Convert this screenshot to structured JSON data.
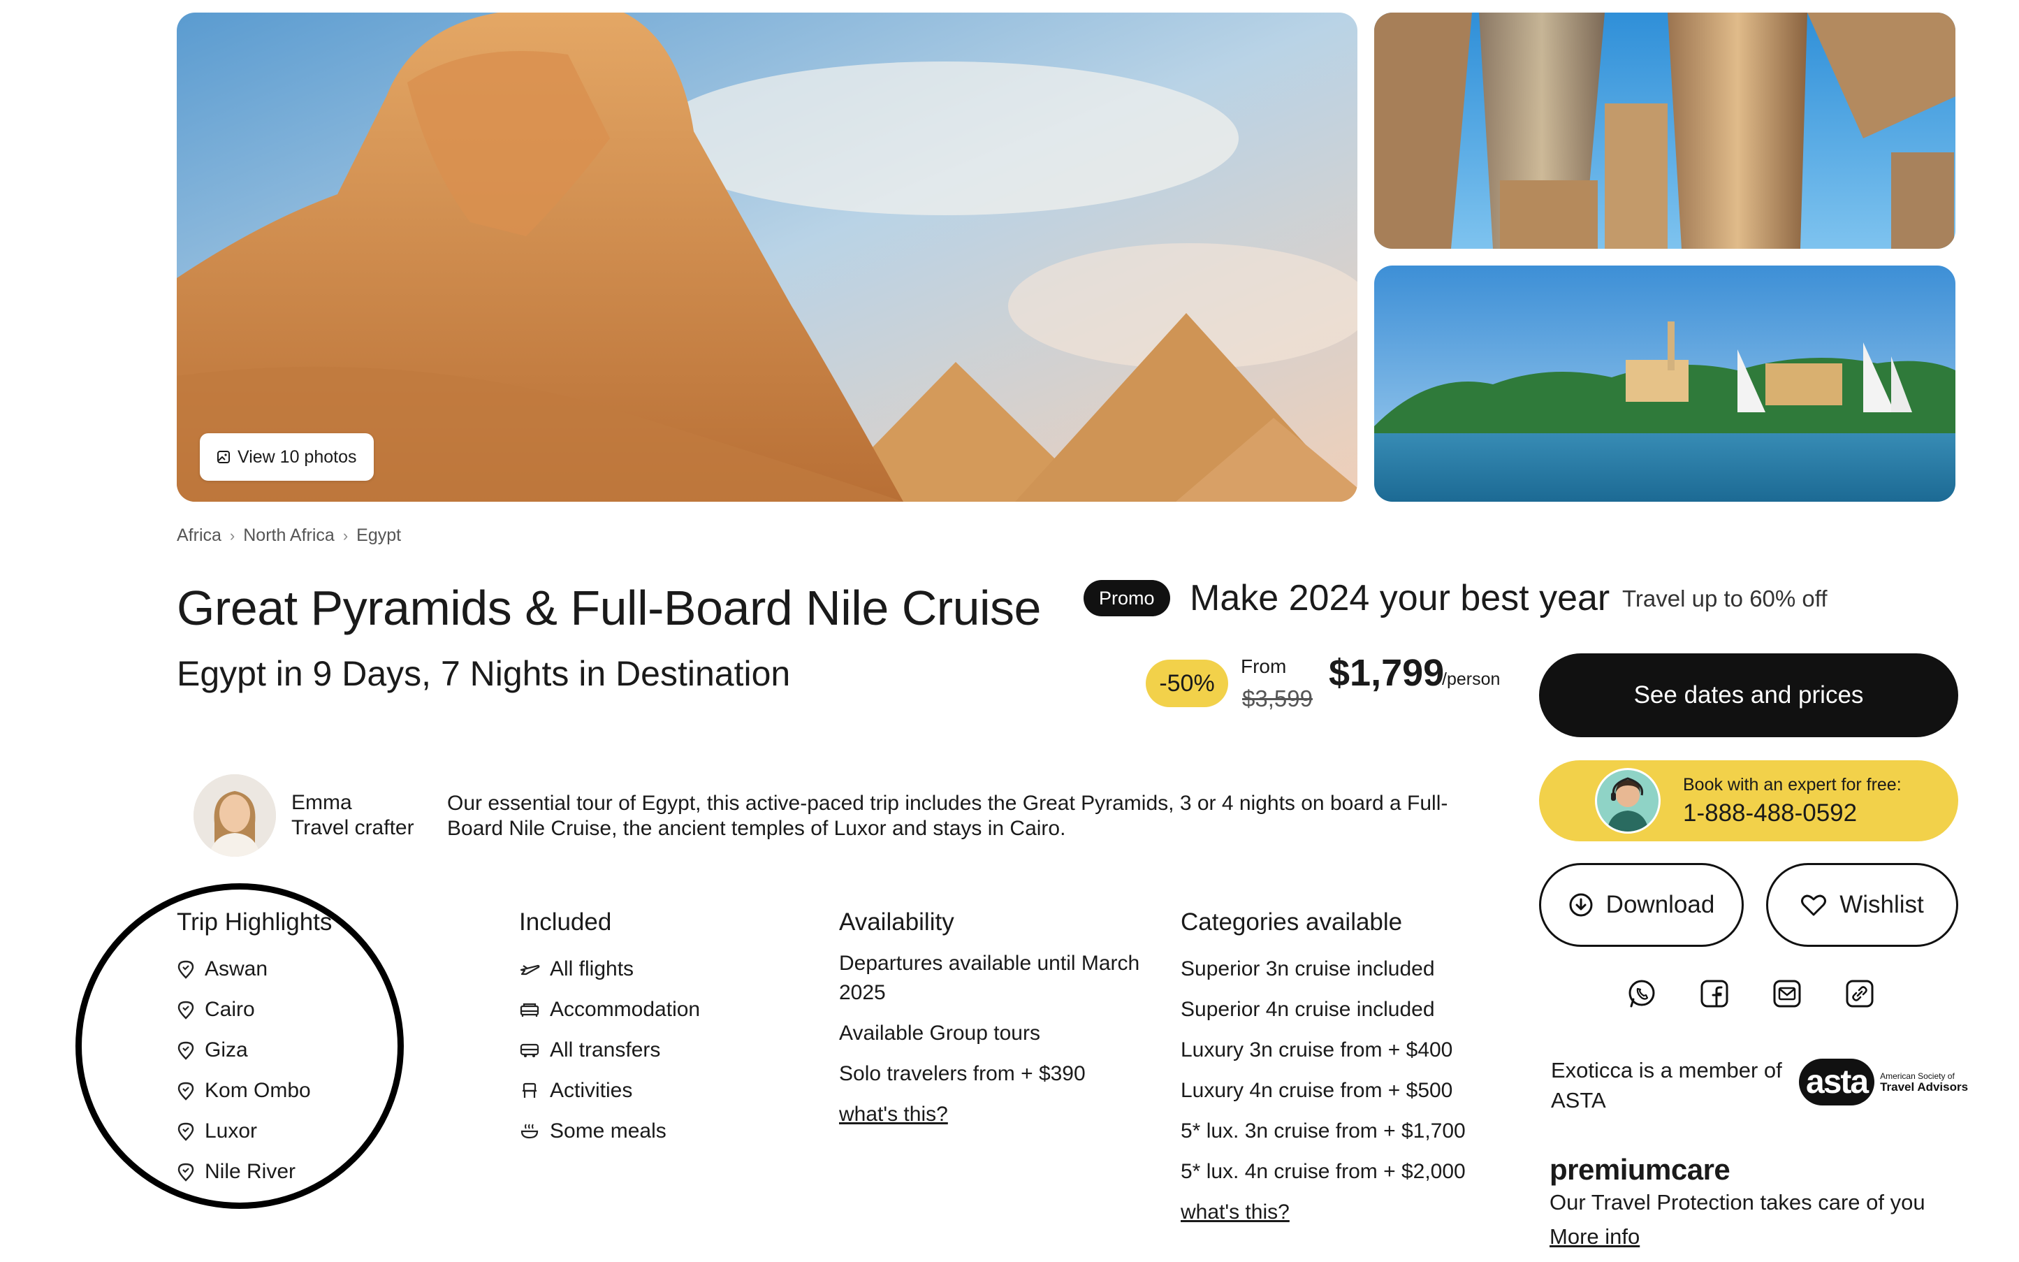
{
  "gallery": {
    "view_photos_label": "View 10 photos",
    "main_photo_alt": "Great Sphinx and pyramids of Giza",
    "top_photo_alt": "Karnak temple columns",
    "bottom_photo_alt": "Nile river with feluccas at Aswan"
  },
  "breadcrumb": [
    "Africa",
    "North Africa",
    "Egypt"
  ],
  "title": "Great Pyramids & Full-Board Nile Cruise",
  "subtitle": "Egypt in 9 Days, 7 Nights in Destination",
  "promo": {
    "badge": "Promo",
    "headline": "Make 2024 your best year",
    "sub": "Travel up to 60% off"
  },
  "pricing": {
    "discount": "-50%",
    "from_label": "From",
    "old_price": "$3,599",
    "current_price": "$1,799",
    "unit": "/person"
  },
  "cta": {
    "see_dates": "See dates and prices",
    "expert_label": "Book with an expert for free:",
    "expert_phone": "1-888-488-0592",
    "download": "Download",
    "wishlist": "Wishlist"
  },
  "share_icons": [
    "whatsapp-icon",
    "facebook-icon",
    "email-icon",
    "link-icon"
  ],
  "asta": {
    "text": "Exoticca is a member of ASTA",
    "mark": "asta",
    "caption_small": "American Society of",
    "caption_bold": "Travel Advisors"
  },
  "premiumcare": {
    "title": "premiumcare",
    "desc": "Our Travel Protection takes care of you",
    "link": "More info"
  },
  "crafter": {
    "name": "Emma",
    "role": "Travel crafter",
    "description": "Our essential tour of Egypt, this active-paced trip includes the Great Pyramids, 3 or 4 nights on board a Full-Board Nile Cruise, the ancient temples of Luxor and stays in Cairo."
  },
  "highlights": {
    "title": "Trip Highlights",
    "items": [
      "Aswan",
      "Cairo",
      "Giza",
      "Kom Ombo",
      "Luxor",
      "Nile River"
    ]
  },
  "included": {
    "title": "Included",
    "items": [
      {
        "label": "All flights",
        "icon": "plane-icon"
      },
      {
        "label": "Accommodation",
        "icon": "bed-icon"
      },
      {
        "label": "All transfers",
        "icon": "bus-icon"
      },
      {
        "label": "Activities",
        "icon": "activity-icon"
      },
      {
        "label": "Some meals",
        "icon": "meal-icon"
      }
    ]
  },
  "availability": {
    "title": "Availability",
    "items": [
      "Departures available until March 2025",
      "Available Group tours",
      "Solo travelers from + $390"
    ],
    "link": "what's this?"
  },
  "categories": {
    "title": "Categories available",
    "items": [
      "Superior 3n cruise included",
      "Superior 4n cruise included",
      "Luxury 3n cruise from + $400",
      "Luxury 4n cruise from + $500",
      "5* lux. 3n cruise from + $1,700",
      "5* lux. 4n cruise from + $2,000"
    ],
    "link": "what's this?"
  },
  "colors": {
    "accent_yellow": "#f2d14a",
    "primary_black": "#111111",
    "annotation_circle": "#000000"
  }
}
